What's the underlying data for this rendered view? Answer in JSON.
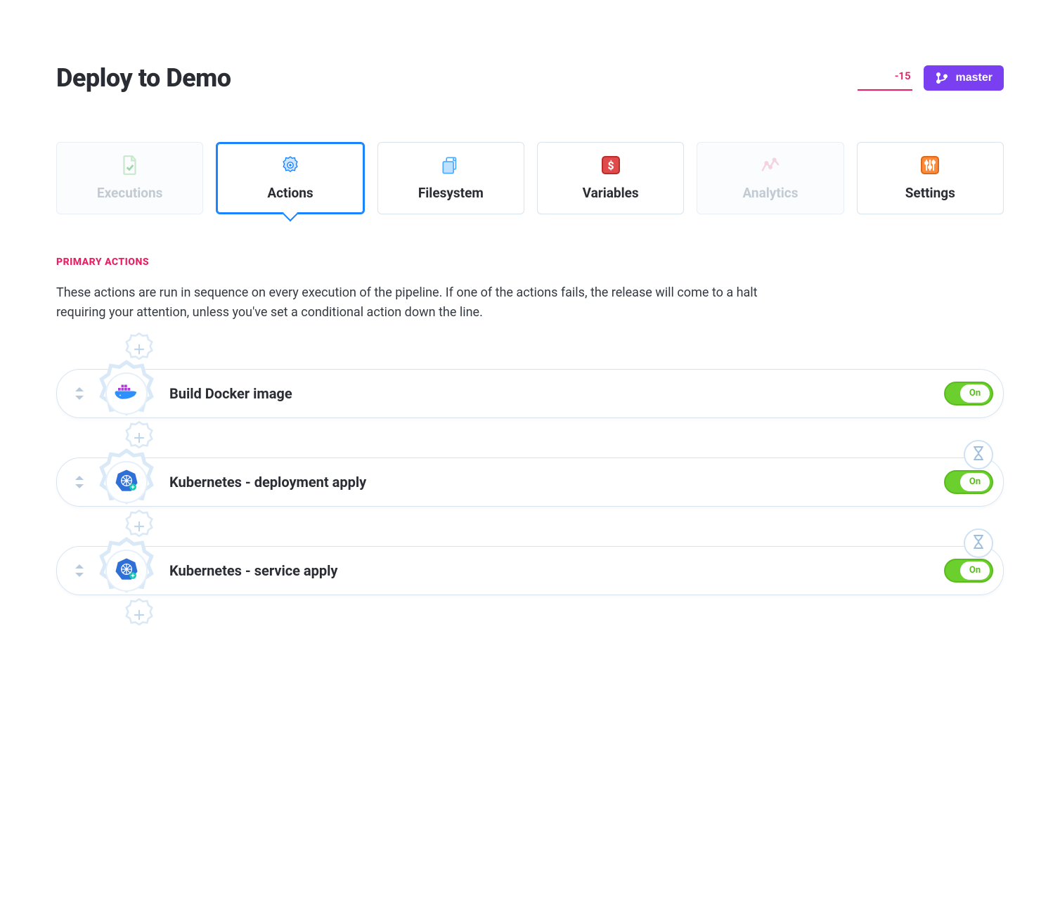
{
  "header": {
    "title": "Deploy to Demo",
    "changes_count": "-15",
    "branch_label": "master"
  },
  "tabs": [
    {
      "key": "executions",
      "label": "Executions",
      "state": "disabled"
    },
    {
      "key": "actions",
      "label": "Actions",
      "state": "active"
    },
    {
      "key": "filesystem",
      "label": "Filesystem",
      "state": "normal"
    },
    {
      "key": "variables",
      "label": "Variables",
      "state": "normal"
    },
    {
      "key": "analytics",
      "label": "Analytics",
      "state": "disabled"
    },
    {
      "key": "settings",
      "label": "Settings",
      "state": "normal"
    }
  ],
  "section": {
    "heading": "PRIMARY ACTIONS",
    "description": "These actions are run in sequence on every execution of the pipeline. If one of the actions fails, the release will come to a halt requiring your attention, unless you've set a conditional action down the line."
  },
  "actions": [
    {
      "title": "Build Docker image",
      "icon": "docker-icon",
      "toggle": "On",
      "wait_before": false
    },
    {
      "title": "Kubernetes - deployment apply",
      "icon": "kubernetes-icon",
      "toggle": "On",
      "wait_before": true
    },
    {
      "title": "Kubernetes - service apply",
      "icon": "kubernetes-icon",
      "toggle": "On",
      "wait_before": true
    }
  ]
}
